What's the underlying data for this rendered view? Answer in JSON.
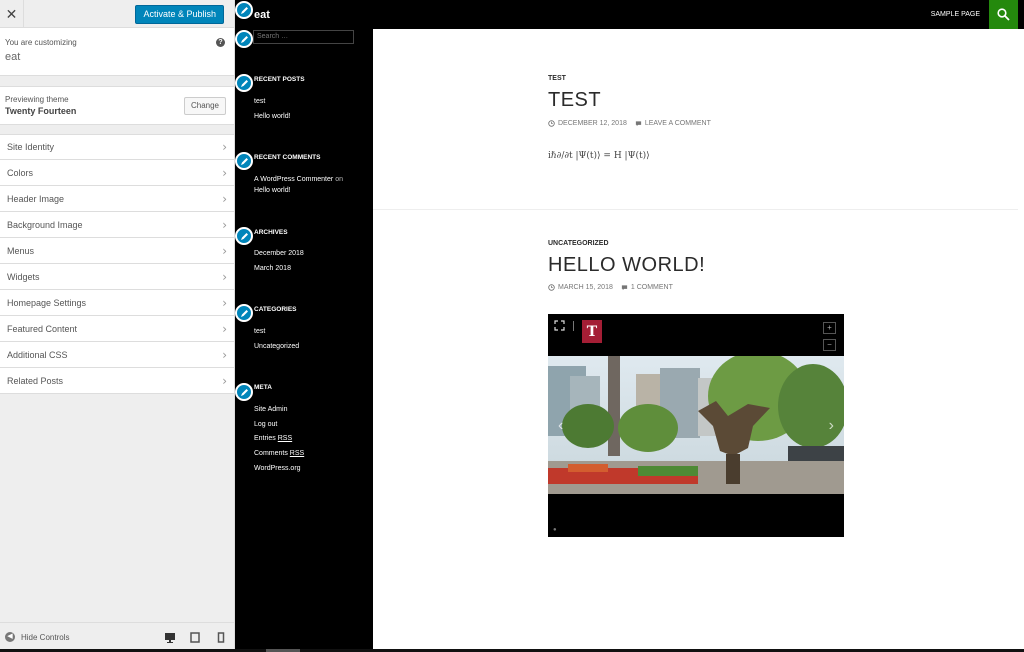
{
  "customizer": {
    "close_label": "✕",
    "publish_label": "Activate & Publish",
    "you_are_customizing": "You are customizing",
    "site_name": "eat",
    "help_label": "?",
    "previewing_theme_label": "Previewing theme",
    "theme_name": "Twenty Fourteen",
    "change_label": "Change",
    "sections": [
      {
        "label": "Site Identity"
      },
      {
        "label": "Colors"
      },
      {
        "label": "Header Image"
      },
      {
        "label": "Background Image"
      },
      {
        "label": "Menus"
      },
      {
        "label": "Widgets"
      },
      {
        "label": "Homepage Settings"
      },
      {
        "label": "Featured Content"
      },
      {
        "label": "Additional CSS"
      },
      {
        "label": "Related Posts"
      }
    ],
    "hide_controls_label": "Hide Controls"
  },
  "preview": {
    "site_title": "eat",
    "nav_sample_page": "SAMPLE PAGE",
    "search_placeholder": "Search …",
    "sidebar": {
      "recent_posts_heading": "RECENT POSTS",
      "recent_posts": [
        "test",
        "Hello world!"
      ],
      "recent_comments_heading": "RECENT COMMENTS",
      "comment_author": "A WordPress Commenter",
      "comment_on": "on",
      "comment_post": "Hello world!",
      "archives_heading": "ARCHIVES",
      "archives": [
        "December 2018",
        "March 2018"
      ],
      "categories_heading": "CATEGORIES",
      "categories": [
        "test",
        "Uncategorized"
      ],
      "meta_heading": "META",
      "meta_links": {
        "site_admin": "Site Admin",
        "log_out": "Log out",
        "entries_prefix": "Entries",
        "comments_prefix": "Comments",
        "rss": "RSS",
        "wordpress_org": "WordPress.org"
      }
    },
    "posts": [
      {
        "category": "TEST",
        "title": "TEST",
        "date": "DECEMBER 12, 2018",
        "comments": "LEAVE A COMMENT",
        "formula": "iℏ∂/∂t |Ψ(t)⟩ = H |Ψ(t)⟩"
      },
      {
        "category": "UNCATEGORIZED",
        "title": "HELLO WORLD!",
        "date": "MARCH 15, 2018",
        "comments": "1 COMMENT"
      }
    ],
    "image_logo_letter": "T",
    "image_zoom_in": "+",
    "image_zoom_out": "−"
  },
  "colors": {
    "accent_blue": "#0085ba",
    "search_green": "#24890d",
    "temple_red": "#a41e35"
  },
  "icons": [
    "close-icon",
    "help-icon",
    "chevron-right-icon",
    "pencil-icon",
    "search-icon",
    "clock-icon",
    "comment-icon",
    "desktop-icon",
    "tablet-icon",
    "mobile-icon",
    "expand-icon",
    "arrow-left-icon"
  ]
}
